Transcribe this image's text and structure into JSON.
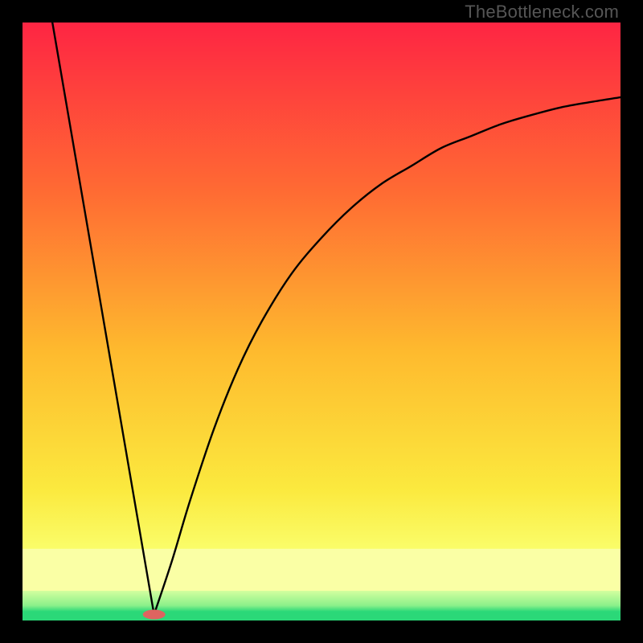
{
  "watermark": "TheBottleneck.com",
  "chart_data": {
    "type": "line",
    "title": "",
    "xlabel": "",
    "ylabel": "",
    "xlim": [
      0,
      100
    ],
    "ylim": [
      0,
      100
    ],
    "grid": false,
    "legend": false,
    "gradient_colors": {
      "top": "#fe2543",
      "upper_mid": "#ff8d2e",
      "mid": "#fed730",
      "lower_mid": "#fafd69",
      "band": "#faffa5",
      "bottom": "#2bd878"
    },
    "background_bands": [
      {
        "y0": 0,
        "y1": 1.5,
        "role": "green-baseline"
      },
      {
        "y0": 1.5,
        "y1": 5,
        "role": "pale-green"
      },
      {
        "y0": 5,
        "y1": 12,
        "role": "pale-yellow-band"
      }
    ],
    "series": [
      {
        "name": "left-limb",
        "x": [
          5,
          22
        ],
        "y": [
          100,
          1
        ],
        "shape": "linear"
      },
      {
        "name": "right-limb",
        "x": [
          22,
          25,
          28,
          32,
          36,
          40,
          45,
          50,
          55,
          60,
          65,
          70,
          75,
          80,
          85,
          90,
          95,
          100
        ],
        "y": [
          1,
          10,
          20,
          32,
          42,
          50,
          58,
          64,
          69,
          73,
          76,
          79,
          81,
          83,
          84.5,
          85.8,
          86.7,
          87.5
        ],
        "shape": "concave-increasing"
      }
    ],
    "marker": {
      "name": "vertex-marker",
      "x": 22,
      "y": 1,
      "color": "#de6460",
      "rx": 14,
      "ry": 6
    }
  }
}
